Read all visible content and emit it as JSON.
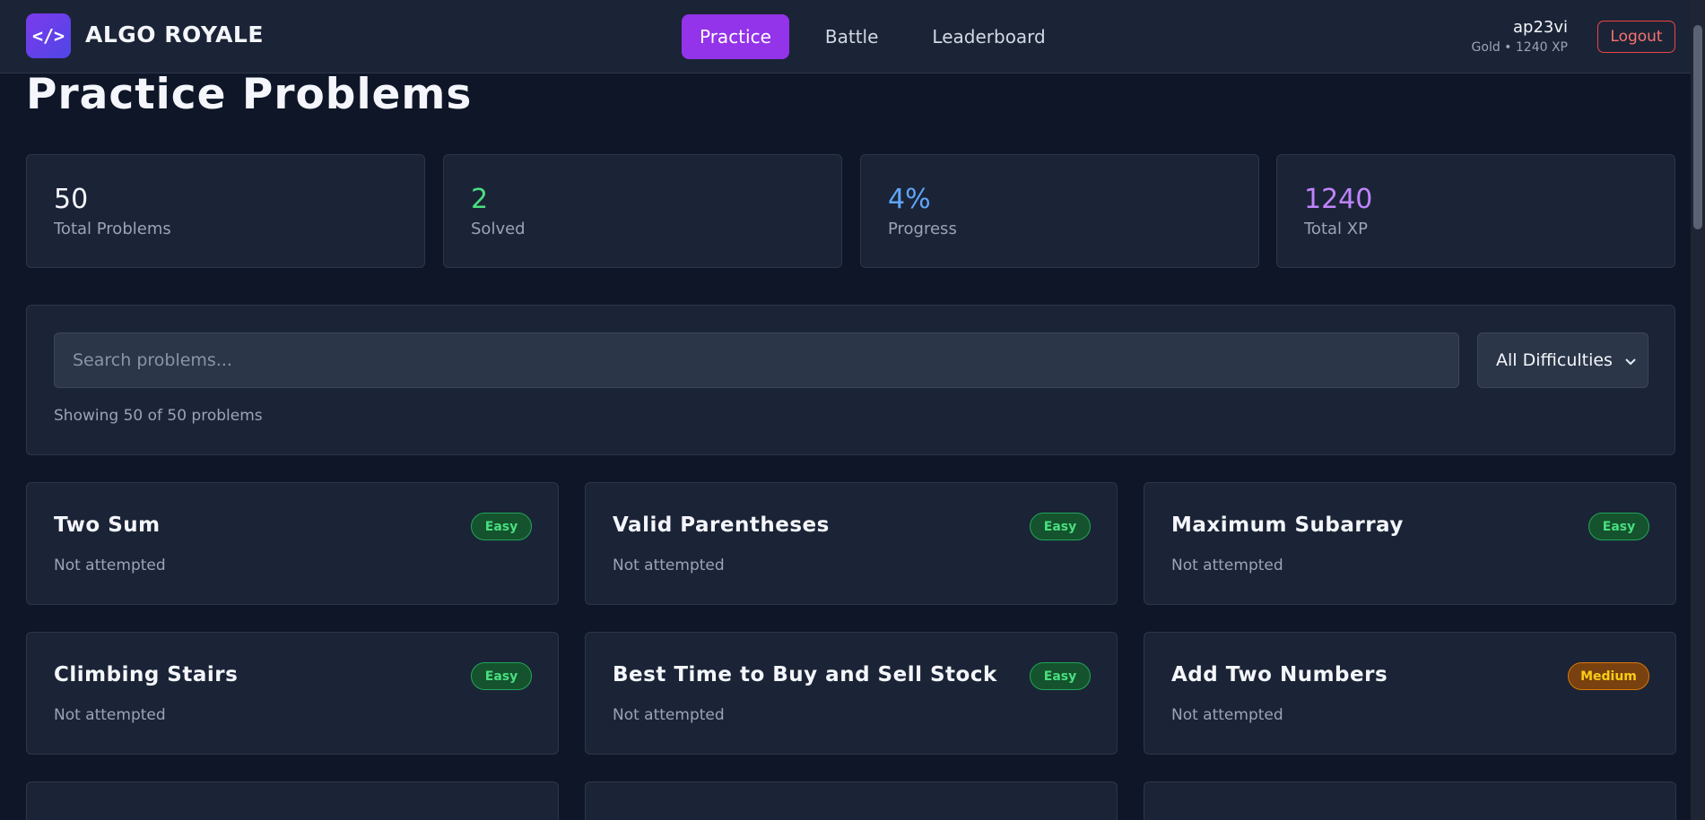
{
  "header": {
    "logo_icon": "</>",
    "logo_text": "ALGO ROYALE",
    "nav": [
      {
        "label": "Practice",
        "active": true
      },
      {
        "label": "Battle",
        "active": false
      },
      {
        "label": "Leaderboard",
        "active": false
      }
    ],
    "user": {
      "name": "ap23vi",
      "meta": "Gold • 1240 XP"
    },
    "logout_label": "Logout"
  },
  "page_title": "Practice Problems",
  "stats": [
    {
      "value": "50",
      "label": "Total Problems",
      "color": "#f4f6fb"
    },
    {
      "value": "2",
      "label": "Solved",
      "color": "#4ade80"
    },
    {
      "value": "4%",
      "label": "Progress",
      "color": "#60a5fa"
    },
    {
      "value": "1240",
      "label": "Total XP",
      "color": "#c084fc"
    }
  ],
  "filters": {
    "search_placeholder": "Search problems...",
    "difficulty_selected": "All Difficulties",
    "showing_text": "Showing 50 of 50 problems"
  },
  "problems": [
    {
      "title": "Two Sum",
      "difficulty": "Easy",
      "status": "Not attempted"
    },
    {
      "title": "Valid Parentheses",
      "difficulty": "Easy",
      "status": "Not attempted"
    },
    {
      "title": "Maximum Subarray",
      "difficulty": "Easy",
      "status": "Not attempted"
    },
    {
      "title": "Climbing Stairs",
      "difficulty": "Easy",
      "status": "Not attempted"
    },
    {
      "title": "Best Time to Buy and Sell Stock",
      "difficulty": "Easy",
      "status": "Not attempted"
    },
    {
      "title": "Add Two Numbers",
      "difficulty": "Medium",
      "status": "Not attempted"
    }
  ],
  "colors": {
    "accent": "#9333ea",
    "background": "#0e1628",
    "card": "#1b2436"
  }
}
